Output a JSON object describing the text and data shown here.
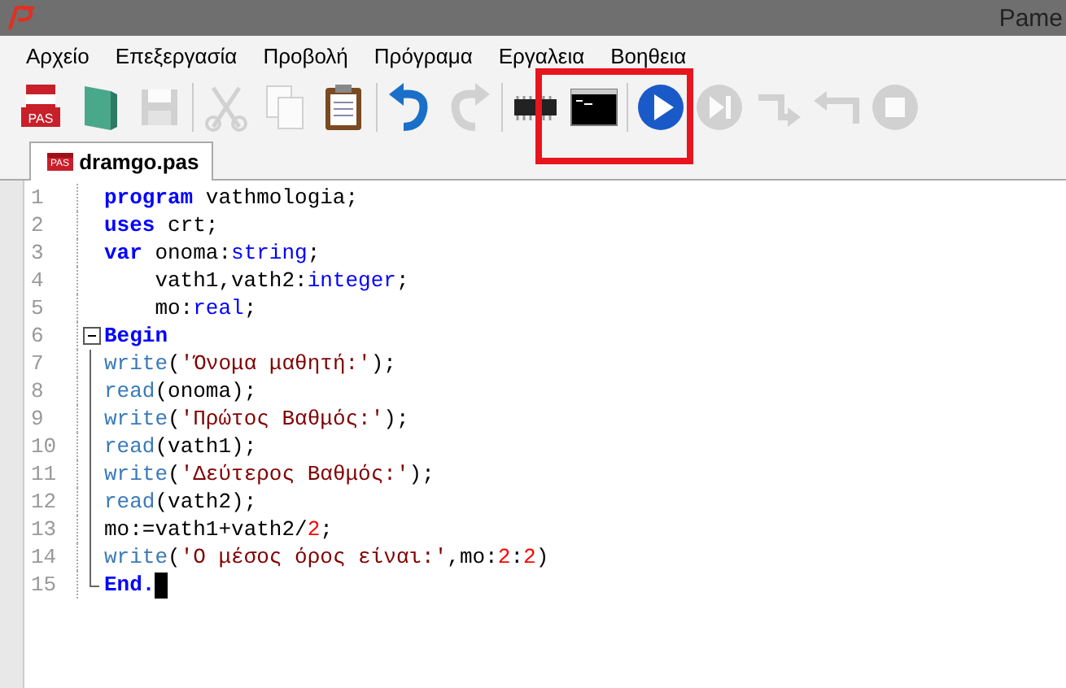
{
  "window": {
    "title": "Pame"
  },
  "menu": [
    "Αρχείο",
    "Επεξεργασία",
    "Προβολή",
    "Πρόγραμα",
    "Εργαλεια",
    "Βοηθεια"
  ],
  "toolbar": [
    {
      "kind": "new",
      "badge": "PAS",
      "disabled": false
    },
    {
      "kind": "open",
      "disabled": false
    },
    {
      "kind": "save",
      "disabled": true
    },
    {
      "kind": "sep"
    },
    {
      "kind": "cut",
      "disabled": true
    },
    {
      "kind": "copy",
      "disabled": true
    },
    {
      "kind": "paste",
      "disabled": false
    },
    {
      "kind": "sep"
    },
    {
      "kind": "undo",
      "disabled": false
    },
    {
      "kind": "redo",
      "disabled": true
    },
    {
      "kind": "sep"
    },
    {
      "kind": "compile",
      "disabled": false
    },
    {
      "kind": "console",
      "disabled": false
    },
    {
      "kind": "sep"
    },
    {
      "kind": "run",
      "disabled": false
    },
    {
      "kind": "step",
      "disabled": true
    },
    {
      "kind": "stepover",
      "disabled": true
    },
    {
      "kind": "back",
      "disabled": true
    },
    {
      "kind": "stop",
      "disabled": true
    }
  ],
  "tabs": [
    {
      "label": "dramgo.pas",
      "badge": "PAS",
      "selected": true
    }
  ],
  "editor": {
    "lines": [
      {
        "number": "1",
        "tokens": [
          {
            "kind": "keyword",
            "text": "program"
          },
          {
            "kind": "plain",
            "text": " vathmologia;"
          }
        ]
      },
      {
        "number": "2",
        "tokens": [
          {
            "kind": "keyword",
            "text": "uses"
          },
          {
            "kind": "plain",
            "text": " crt;"
          }
        ]
      },
      {
        "number": "3",
        "tokens": [
          {
            "kind": "keyword",
            "text": "var"
          },
          {
            "kind": "plain",
            "text": " onoma:"
          },
          {
            "kind": "type",
            "text": "string"
          },
          {
            "kind": "plain",
            "text": ";"
          }
        ]
      },
      {
        "number": "4",
        "indented": true,
        "tokens": [
          {
            "kind": "plain",
            "text": "vath1,vath2:"
          },
          {
            "kind": "type",
            "text": "integer"
          },
          {
            "kind": "plain",
            "text": ";"
          }
        ]
      },
      {
        "number": "5",
        "indented": true,
        "tokens": [
          {
            "kind": "plain",
            "text": "mo:"
          },
          {
            "kind": "type",
            "text": "real"
          },
          {
            "kind": "plain",
            "text": ";"
          }
        ]
      },
      {
        "number": "6",
        "fold": true,
        "tokens": [
          {
            "kind": "keyword",
            "text": "Begin"
          }
        ]
      },
      {
        "number": "7",
        "tokens": [
          {
            "kind": "builtin",
            "text": "write"
          },
          {
            "kind": "plain",
            "text": "("
          },
          {
            "kind": "string",
            "text": "'Όνομα μαθητή:'"
          },
          {
            "kind": "plain",
            "text": ");"
          }
        ]
      },
      {
        "number": "8",
        "tokens": [
          {
            "kind": "builtin",
            "text": "read"
          },
          {
            "kind": "plain",
            "text": "(onoma);"
          }
        ]
      },
      {
        "number": "9",
        "tokens": [
          {
            "kind": "builtin",
            "text": "write"
          },
          {
            "kind": "plain",
            "text": "("
          },
          {
            "kind": "string",
            "text": "'Πρώτος Βαθμός:'"
          },
          {
            "kind": "plain",
            "text": ");"
          }
        ]
      },
      {
        "number": "10",
        "tokens": [
          {
            "kind": "builtin",
            "text": "read"
          },
          {
            "kind": "plain",
            "text": "(vath1);"
          }
        ]
      },
      {
        "number": "11",
        "tokens": [
          {
            "kind": "builtin",
            "text": "write"
          },
          {
            "kind": "plain",
            "text": "("
          },
          {
            "kind": "string",
            "text": "'Δεύτερος Βαθμός:'"
          },
          {
            "kind": "plain",
            "text": ");"
          }
        ]
      },
      {
        "number": "12",
        "tokens": [
          {
            "kind": "builtin",
            "text": "read"
          },
          {
            "kind": "plain",
            "text": "(vath2);"
          }
        ]
      },
      {
        "number": "13",
        "tokens": [
          {
            "kind": "plain",
            "text": "mo:=vath1+vath2/"
          },
          {
            "kind": "number",
            "text": "2"
          },
          {
            "kind": "plain",
            "text": ";"
          }
        ]
      },
      {
        "number": "14",
        "tokens": [
          {
            "kind": "builtin",
            "text": "write"
          },
          {
            "kind": "plain",
            "text": "("
          },
          {
            "kind": "string",
            "text": "'Ο μέσος όρος είναι:'"
          },
          {
            "kind": "plain",
            "text": ",mo:"
          },
          {
            "kind": "number",
            "text": "2"
          },
          {
            "kind": "plain",
            "text": ":"
          },
          {
            "kind": "number",
            "text": "2"
          },
          {
            "kind": "plain",
            "text": ")"
          }
        ]
      },
      {
        "number": "15",
        "cursor": true,
        "tokens": [
          {
            "kind": "keyword",
            "text": "End."
          }
        ]
      }
    ]
  }
}
